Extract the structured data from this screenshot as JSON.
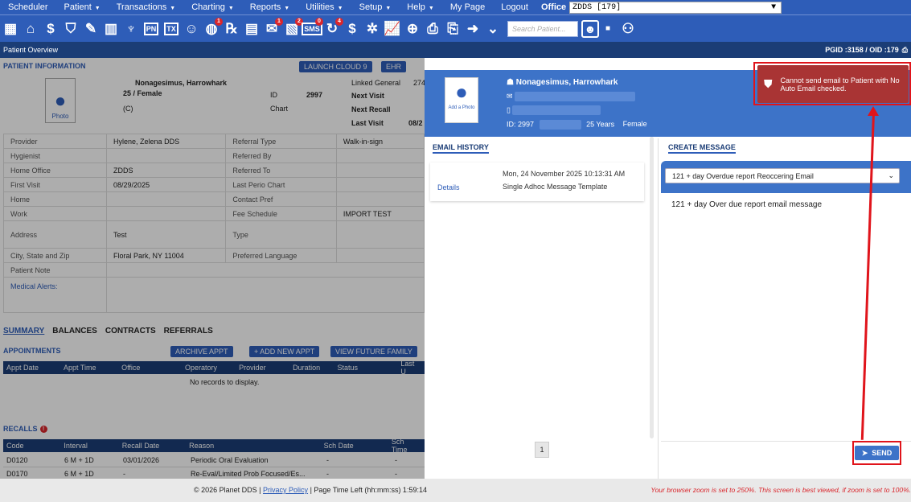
{
  "menu": {
    "items": [
      {
        "label": "Scheduler",
        "caret": false
      },
      {
        "label": "Patient",
        "caret": true
      },
      {
        "label": "Transactions",
        "caret": true
      },
      {
        "label": "Charting",
        "caret": true
      },
      {
        "label": "Reports",
        "caret": true
      },
      {
        "label": "Utilities",
        "caret": true
      },
      {
        "label": "Setup",
        "caret": true
      },
      {
        "label": "Help",
        "caret": true
      },
      {
        "label": "My Page",
        "caret": false
      },
      {
        "label": "Logout",
        "caret": false
      }
    ],
    "office_label": "Office",
    "office_value": "ZDDS [179]"
  },
  "toolbar": {
    "search_placeholder": "Search Patient...",
    "badges": {
      "alerts": "1",
      "messages": "1",
      "notes": "2",
      "sms": "0",
      "reminders": "4"
    },
    "pn_label": "PN",
    "tx_label": "TX",
    "sms_label": "SMS"
  },
  "header": {
    "title": "Patient Overview",
    "pgid": "PGID :3158 / OID :179"
  },
  "patient_info": {
    "section_title": "PATIENT INFORMATION",
    "launch_cloud": "LAUNCH CLOUD 9",
    "ehr": "EHR",
    "photo_label": "Photo",
    "name": "Nonagesimus, Harrowhark",
    "age_gender": "25 / Female",
    "id_label": "ID",
    "id_value": "2997",
    "chart_label": "Chart",
    "c_label": "(C)",
    "linked_general": "Linked General",
    "linked_general_value": "274",
    "next_visit": "Next Visit",
    "next_recall": "Next Recall",
    "last_visit": "Last Visit",
    "last_visit_value": "08/2",
    "rows": [
      {
        "l1": "Provider",
        "v1": "Hylene, Zelena DDS",
        "l2": "Referral Type",
        "v2": "Walk-in-sign"
      },
      {
        "l1": "Hygienist",
        "v1": "",
        "l2": "Referred By",
        "v2": ""
      },
      {
        "l1": "Home Office",
        "v1": "ZDDS",
        "l2": "Referred To",
        "v2": ""
      },
      {
        "l1": "First Visit",
        "v1": "08/29/2025",
        "l2": "Last Perio Chart",
        "v2": ""
      },
      {
        "l1": "Home",
        "v1": "",
        "l2": "Contact Pref",
        "v2": ""
      },
      {
        "l1": "Work",
        "v1": "",
        "l2": "Fee Schedule",
        "v2": "IMPORT TEST"
      },
      {
        "l1": "Address",
        "v1": "Test",
        "l2": "Type",
        "v2": ""
      },
      {
        "l1": "City, State and Zip",
        "v1": "Floral Park, NY 11004",
        "l2": "Preferred Language",
        "v2": ""
      },
      {
        "l1": "Patient Note",
        "v1": "",
        "l2": "",
        "v2": ""
      },
      {
        "l1": "Medical Alerts:",
        "v1": "",
        "l2": "",
        "v2": ""
      }
    ]
  },
  "tabs": [
    "SUMMARY",
    "BALANCES",
    "CONTRACTS",
    "REFERRALS"
  ],
  "appointments": {
    "title": "APPOINTMENTS",
    "archive": "ARCHIVE APPT",
    "add_new": "+ ADD NEW APPT",
    "view_future": "VIEW FUTURE FAMILY",
    "columns": [
      "Appt Date",
      "Appt Time",
      "Office",
      "Operatory",
      "Provider",
      "Duration",
      "Status",
      "Last U"
    ],
    "empty": "No records to display."
  },
  "recalls": {
    "title": "RECALLS",
    "columns": [
      "Code",
      "Interval",
      "Recall Date",
      "Reason",
      "Sch Date",
      "Sch Time"
    ],
    "rows": [
      [
        "D0120",
        "6 M + 1D",
        "03/01/2026",
        "Periodic Oral Evaluation",
        "-",
        "-"
      ],
      [
        "D0170",
        "6 M + 1D",
        "-",
        "Re-Eval/Limited Prob Focused/Es...",
        "-",
        "-"
      ]
    ]
  },
  "modal": {
    "add_photo": "Add a Photo",
    "name": "Nonagesimus, Harrowhark",
    "id": "ID: 2997",
    "age": "25 Years",
    "gender": "Female",
    "email_history_tab": "EMAIL HISTORY",
    "create_message_tab": "CREATE MESSAGE",
    "history": {
      "date": "Mon, 24 November 2025 10:13:31 AM",
      "details": "Details",
      "template": "Single Adhoc Message Template"
    },
    "page": "1",
    "template_value": "121 + day Overdue report Reoccering Email",
    "message": "121 + day Over due report email message",
    "send": "SEND"
  },
  "toast": {
    "message": "Cannot send email to Patient with No Auto Email checked."
  },
  "footer": {
    "copyright": "© 2026 Planet DDS |",
    "privacy": "Privacy Policy",
    "time_left": "| Page Time Left (hh:mm:ss) 1:59:14",
    "zoom_warning": "Your browser zoom is set to 250%. This screen is best viewed, if zoom is set to 100%."
  },
  "colors": {
    "brand_blue": "#2e5db8",
    "dark_navy": "#1b3d76",
    "error_red": "#a93434",
    "highlight_red": "#e0141b"
  }
}
